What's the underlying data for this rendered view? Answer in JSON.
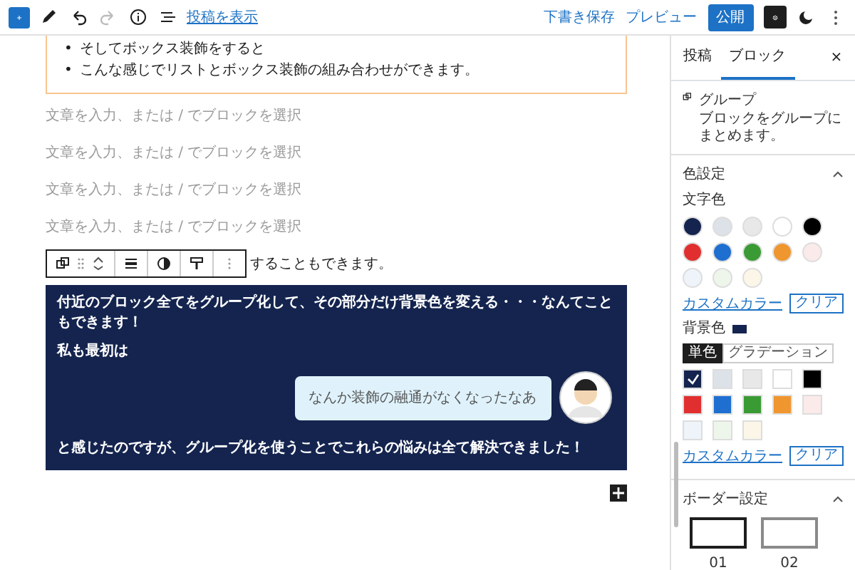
{
  "top_bar": {
    "view_post": "投稿を表示",
    "redo": {
      "disabled": true
    },
    "save_draft": "下書き保存",
    "preview": "プレビュー",
    "publish": "公開",
    "settings": {
      "on": true
    }
  },
  "editor": {
    "list_items": [
      {
        "marker": "•",
        "text": "そしてボックス装飾をすると"
      },
      {
        "marker": "•",
        "text": "こんな感じでリストとボックス装飾の組み合わせができます。"
      }
    ],
    "placeholders": [
      "文章を入力、または / でブロックを選択",
      "文章を入力、または / でブロックを選択",
      "文章を入力、または / でブロックを選択",
      "文章を入力、または / でブロックを選択"
    ],
    "partial_text": "することもできます。",
    "group_block": {
      "paragraphs": [
        "付近のブロック全てをグループ化して、その部分だけ背景色を変える・・・なんてこともできます！",
        "私も最初は"
      ],
      "bubble": "なんか装飾の融通がなくなったなあ",
      "closing": "と感じたのですが、グループ化を使うことでこれらの悩みは全て解決できました！"
    }
  },
  "sidebar": {
    "tabs": [
      {
        "label": "投稿",
        "selected": false
      },
      {
        "label": "ブロック",
        "selected": true
      }
    ],
    "close": "×",
    "block": {
      "name": "グループ",
      "description": "ブロックをグループにまとめます。"
    },
    "color_panel": {
      "title": "色設定",
      "expanded": true,
      "text_color": {
        "label": "文字色",
        "swatches": [
          {
            "color": "#14244f",
            "selected": false
          },
          {
            "color": "#dde1e8",
            "selected": false
          },
          {
            "color": "#e8e8e8",
            "selected": false
          },
          {
            "color": "#ffffff",
            "selected": false
          },
          {
            "color": "#000000",
            "selected": false
          },
          {
            "color": "#e12f2f",
            "selected": false
          },
          {
            "color": "#1e6fd0",
            "selected": false
          },
          {
            "color": "#3a9b35",
            "selected": false
          },
          {
            "color": "#f0962e",
            "selected": false
          },
          {
            "color": "#fbeaea",
            "selected": false
          },
          {
            "color": "#eef4fa",
            "selected": false
          },
          {
            "color": "#eef6ec",
            "selected": false
          },
          {
            "color": "#fbf6e8",
            "selected": false
          }
        ],
        "custom": "カスタムカラー",
        "clear": "クリア"
      },
      "background": {
        "label": "背景色",
        "modes": [
          {
            "label": "単色",
            "selected": true
          },
          {
            "label": "グラデーション",
            "selected": false
          }
        ],
        "swatches": [
          {
            "color": "#14244f",
            "selected": true
          },
          {
            "color": "#dde1e8",
            "selected": false
          },
          {
            "color": "#e8e8e8",
            "selected": false
          },
          {
            "color": "#ffffff",
            "selected": false
          },
          {
            "color": "#000000",
            "selected": false
          },
          {
            "color": "#e12f2f",
            "selected": false
          },
          {
            "color": "#1e6fd0",
            "selected": false
          },
          {
            "color": "#3a9b35",
            "selected": false
          },
          {
            "color": "#f0962e",
            "selected": false
          },
          {
            "color": "#fbeaea",
            "selected": false
          },
          {
            "color": "#eef4fa",
            "selected": false
          },
          {
            "color": "#eef6ec",
            "selected": false
          },
          {
            "color": "#fbf6e8",
            "selected": false
          }
        ],
        "custom": "カスタムカラー",
        "clear": "クリア"
      }
    },
    "border_panel": {
      "title": "ボーダー設定",
      "expanded": true,
      "styles": [
        {
          "label": "01",
          "color": "#1e1e1e"
        },
        {
          "label": "02",
          "color": "#8a8a8a"
        }
      ]
    }
  }
}
